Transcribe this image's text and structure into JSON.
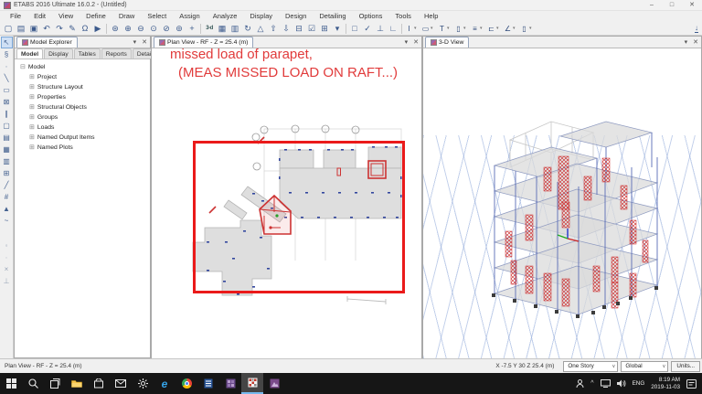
{
  "window": {
    "title": "ETABS 2016 Ultimate 16.0.2 - (Untitled)",
    "minimize": "–",
    "maximize": "□",
    "close": "✕"
  },
  "menu": {
    "items": [
      "File",
      "Edit",
      "View",
      "Define",
      "Draw",
      "Select",
      "Assign",
      "Analyze",
      "Display",
      "Design",
      "Detailing",
      "Options",
      "Tools",
      "Help"
    ]
  },
  "toolbar": {
    "icons": [
      {
        "name": "new-model-icon",
        "glyph": "▢"
      },
      {
        "name": "open-model-icon",
        "glyph": "▤"
      },
      {
        "name": "save-model-icon",
        "glyph": "▣"
      },
      {
        "name": "undo-icon",
        "glyph": "↶"
      },
      {
        "name": "redo-icon",
        "glyph": "↷"
      },
      {
        "name": "refresh-window-icon",
        "glyph": "✎"
      },
      {
        "name": "lock-model-icon",
        "glyph": "Ω"
      },
      {
        "name": "run-analysis-icon",
        "glyph": "▶"
      },
      {
        "name": "zoom-rubber-band-icon",
        "glyph": "⊛"
      },
      {
        "name": "zoom-in-icon",
        "glyph": "⊕"
      },
      {
        "name": "zoom-out-icon",
        "glyph": "⊖"
      },
      {
        "name": "zoom-full-icon",
        "glyph": "⊙"
      },
      {
        "name": "zoom-previous-icon",
        "glyph": "⊘"
      },
      {
        "name": "zoom-one-step-icon",
        "glyph": "⊚"
      },
      {
        "name": "pan-icon",
        "glyph": "+"
      },
      {
        "name": "view-3d-icon",
        "glyph": "3-d"
      },
      {
        "name": "plan-view-icon",
        "glyph": "▦"
      },
      {
        "name": "elevation-view-icon",
        "glyph": "▥"
      },
      {
        "name": "rotate-3d-view-icon",
        "glyph": "↻"
      },
      {
        "name": "perspective-toggle-icon",
        "glyph": "△"
      },
      {
        "name": "move-up-story-icon",
        "glyph": "⇧"
      },
      {
        "name": "move-down-story-icon",
        "glyph": "⇩"
      },
      {
        "name": "shrink-objects-icon",
        "glyph": "⊟"
      },
      {
        "name": "display-options-icon",
        "glyph": "☑"
      },
      {
        "name": "window-layout-icon",
        "glyph": "⊞"
      },
      {
        "name": "more-views-icon",
        "glyph": "▾"
      },
      {
        "name": "rubber-band-select-icon",
        "glyph": "□"
      },
      {
        "name": "clear-selection-icon",
        "glyph": "✓"
      },
      {
        "name": "dimension-horizontal-icon",
        "glyph": "⊥"
      },
      {
        "name": "dimension-vertical-icon",
        "glyph": "∟"
      }
    ],
    "section_tools": [
      {
        "name": "i-section-tool",
        "glyph": "I"
      },
      {
        "name": "rect-section-tool",
        "glyph": "▭"
      },
      {
        "name": "tee-section-tool",
        "glyph": "T"
      },
      {
        "name": "column-section-tool",
        "glyph": "▯"
      },
      {
        "name": "rebar-section-tool",
        "glyph": "≡"
      },
      {
        "name": "channel-section-tool",
        "glyph": "⊏"
      },
      {
        "name": "angle-section-tool",
        "glyph": "∠"
      },
      {
        "name": "pier-section-tool",
        "glyph": "▯"
      }
    ],
    "download_icon": "↓"
  },
  "left_toolbar": {
    "icons": [
      {
        "name": "select-pointer-icon",
        "glyph": "↖"
      },
      {
        "name": "reshape-icon",
        "glyph": "§"
      },
      {
        "name": "draw-joint-icon",
        "glyph": "∙"
      },
      {
        "name": "draw-frame-icon",
        "glyph": "╲"
      },
      {
        "name": "quick-frame-icon",
        "glyph": "▭"
      },
      {
        "name": "quick-braces-icon",
        "glyph": "⊠"
      },
      {
        "name": "quick-secondary-beams-icon",
        "glyph": "∥"
      },
      {
        "name": "draw-floor-icon",
        "glyph": "▢"
      },
      {
        "name": "draw-wall-icon",
        "glyph": "▤"
      },
      {
        "name": "quick-floor-icon",
        "glyph": "▦"
      },
      {
        "name": "quick-wall-icon",
        "glyph": "▥"
      },
      {
        "name": "draw-opening-icon",
        "glyph": "⊞"
      },
      {
        "name": "draw-link-icon",
        "glyph": "╱"
      },
      {
        "name": "draw-grid-icon",
        "glyph": "#"
      },
      {
        "name": "draw-ref-plane-icon",
        "glyph": "▲"
      },
      {
        "name": "draw-wave-icon",
        "glyph": "~"
      },
      {
        "name": "snap-joints-icon",
        "glyph": "◦"
      },
      {
        "name": "snap-midpoint-icon",
        "glyph": "∙"
      },
      {
        "name": "snap-intersection-icon",
        "glyph": "×"
      },
      {
        "name": "snap-perpendicular-icon",
        "glyph": "⊥"
      }
    ]
  },
  "model_explorer": {
    "title": "Model Explorer",
    "tabs": [
      "Model",
      "Display",
      "Tables",
      "Reports",
      "Detailing"
    ],
    "active_tab": "Model",
    "tree": {
      "root": "Model",
      "items": [
        "Project",
        "Structure Layout",
        "Properties",
        "Structural Objects",
        "Groups",
        "Loads",
        "Named Output Items",
        "Named Plots"
      ]
    }
  },
  "plan_view": {
    "tab_title": "Plan View - RF - Z = 25.4 (m)"
  },
  "view_3d": {
    "tab_title": "3-D View"
  },
  "annotation": {
    "line1": "missed load of parapet,",
    "line2": "(MEAS MISSED LOAD ON RAFT...)",
    "color": "#e13b3b"
  },
  "status_bar": {
    "message": "Plan View - RF - Z = 25.4 (m)",
    "coordinates": "X -7.5  Y 30  Z 25.4 (m)",
    "story": "One Story",
    "coord_system": "Global",
    "units": "Units..."
  },
  "taskbar": {
    "icons": [
      "start-icon",
      "search-icon",
      "task-view-icon",
      "file-explorer-icon",
      "store-icon",
      "mail-icon",
      "settings-icon",
      "edge-icon",
      "chrome-icon",
      "word-icon",
      "tiles-app-icon",
      "etabs-app-icon",
      "photos-app-icon"
    ],
    "language": "ENG",
    "time": "8:19 AM",
    "date": "2019-11-03"
  },
  "ui": {
    "caret_down": "▾",
    "close": "✕",
    "select_caret": "∨",
    "tree_collapse": "⊟",
    "tree_expand": "⊞",
    "hidden_icons_chevron": "^"
  },
  "colors": {
    "annotation_red": "#e13b3b",
    "highlight_red": "#ea1a1a",
    "wall_red": "#cc2222",
    "frame_blue": "#5a6cb5",
    "grid_blue": "#91aada",
    "slab_gray": "#dcdcdc",
    "taskbar_bg": "#161616",
    "selection_blue": "#cfe0f5"
  }
}
